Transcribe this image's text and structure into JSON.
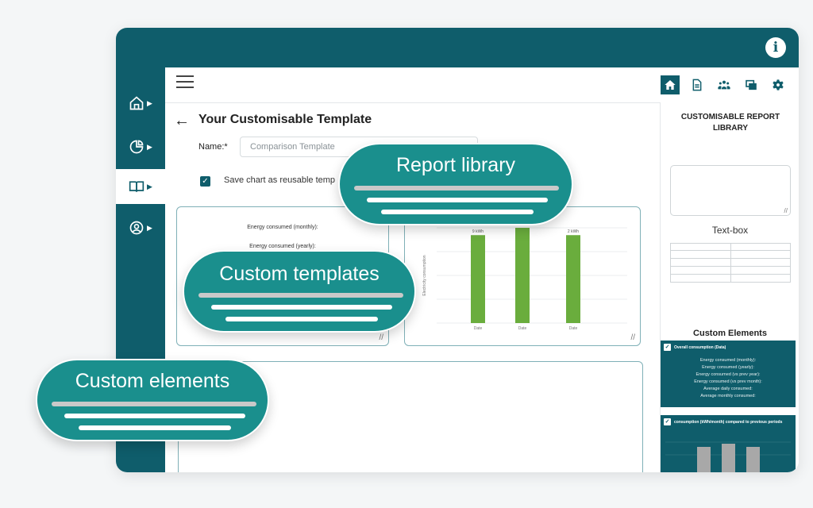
{
  "header": {
    "info_icon": "info-icon"
  },
  "nav": {
    "items": [
      {
        "icon": "home-outline-icon"
      },
      {
        "icon": "pie-chart-icon"
      },
      {
        "icon": "book-icon"
      },
      {
        "icon": "user-circle-icon"
      }
    ]
  },
  "toolbar": {
    "icons": [
      "home-icon",
      "document-icon",
      "users-icon",
      "monitor-icon",
      "gear-icon"
    ]
  },
  "page": {
    "title": "Your Customisable Template",
    "name_label": "Name:*",
    "name_value": "Comparison Template",
    "save_label": "Save chart as reusable temp"
  },
  "kpi_card": {
    "line1": "Energy consumed (monthly):",
    "line2": "Energy consumed (yearly):"
  },
  "chart_data": {
    "type": "bar",
    "categories": [
      "Date",
      "Date",
      "Date"
    ],
    "values": [
      2.4,
      2.6,
      2.4
    ],
    "data_labels": [
      "9 kWh",
      "",
      "2 kWh"
    ],
    "ylabel": "Electricity consumption",
    "title": ""
  },
  "right_panel": {
    "title": "CUSTOMISABLE REPORT LIBRARY",
    "textbox_label": "Text-box",
    "custom_elements_title": "Custom Elements",
    "element1": {
      "title": "Overall consumption (Data)",
      "lines": [
        "Energy consumed (monthly):",
        "Energy consumed (yearly):",
        "Energy consumed (vs prev year):",
        "Energy consumed (vs prev month):",
        "Average daily consumed:",
        "Average monthly consumed:"
      ]
    },
    "element2": {
      "title": "consumption (kWh/month) compared to previous periods"
    }
  },
  "callouts": {
    "report_library": "Report library",
    "custom_templates": "Custom templates",
    "custom_elements": "Custom elements"
  },
  "colors": {
    "primary": "#0f5d6b",
    "callout": "#1a8f8d",
    "bar": "#6aad3d"
  }
}
